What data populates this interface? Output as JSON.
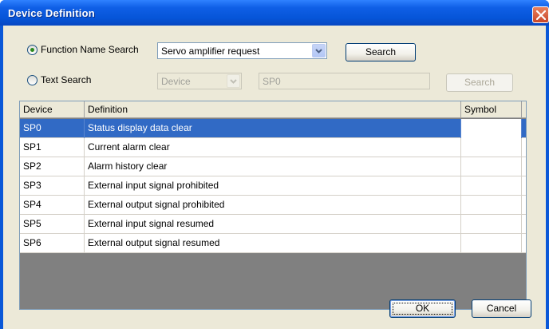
{
  "window": {
    "title": "Device Definition"
  },
  "search": {
    "function_name_label": "Function Name Search",
    "function_name_value": "Servo amplifier request",
    "function_search_button": "Search",
    "text_search_label": "Text Search",
    "device_combo_value": "Device",
    "text_value": "SP0",
    "text_search_button": "Search",
    "selected_mode": "function"
  },
  "table": {
    "headers": [
      "Device",
      "Definition",
      "Symbol"
    ],
    "rows": [
      {
        "device": "SP0",
        "definition": "Status display data clear",
        "symbol": ""
      },
      {
        "device": "SP1",
        "definition": "Current alarm clear",
        "symbol": ""
      },
      {
        "device": "SP2",
        "definition": "Alarm history clear",
        "symbol": ""
      },
      {
        "device": "SP3",
        "definition": "External input signal prohibited",
        "symbol": ""
      },
      {
        "device": "SP4",
        "definition": "External output signal prohibited",
        "symbol": ""
      },
      {
        "device": "SP5",
        "definition": "External input signal resumed",
        "symbol": ""
      },
      {
        "device": "SP6",
        "definition": "External output signal resumed",
        "symbol": ""
      }
    ],
    "selected_index": 0
  },
  "buttons": {
    "ok": "OK",
    "cancel": "Cancel"
  },
  "colors": {
    "title_bar": "#0655d8",
    "selection": "#316ac5",
    "dialog_bg": "#ece9d8"
  }
}
